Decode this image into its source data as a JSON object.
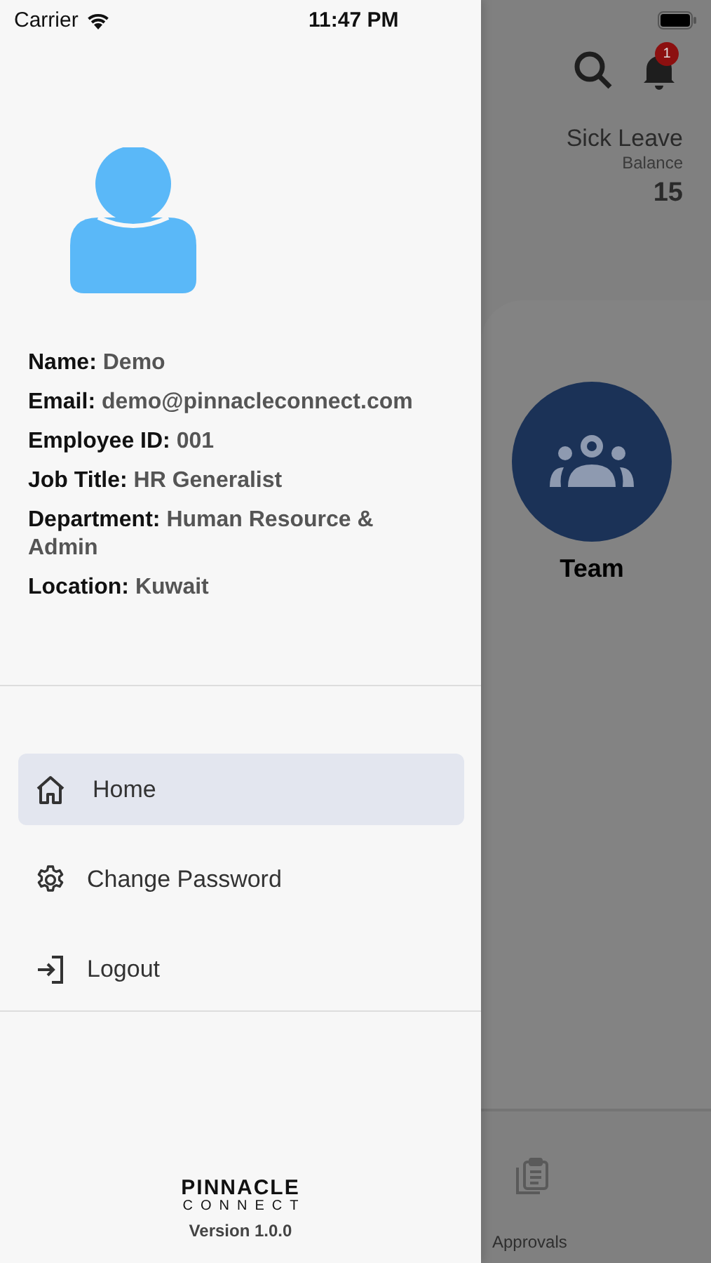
{
  "status_bar": {
    "carrier": "Carrier",
    "time": "11:47 PM"
  },
  "drawer": {
    "profile": [
      {
        "label": "Name:",
        "value": "Demo"
      },
      {
        "label": "Email:",
        "value": "demo@pinnacleconnect.com"
      },
      {
        "label": "Employee ID:",
        "value": "001"
      },
      {
        "label": "Job Title:",
        "value": "HR Generalist"
      },
      {
        "label": "Department:",
        "value": "Human Resource & Admin"
      },
      {
        "label": "Location:",
        "value": "Kuwait"
      }
    ],
    "menu": [
      {
        "label": "Home",
        "kind": "home",
        "selected": true
      },
      {
        "label": "Change Password",
        "kind": "settings",
        "selected": false
      },
      {
        "label": "Logout",
        "kind": "logout",
        "selected": false
      }
    ],
    "footer": {
      "logo_top": "PINNACLE",
      "logo_bottom": "CONNECT",
      "version": "Version 1.0.0"
    }
  },
  "background": {
    "notification_count": "1",
    "leave": {
      "title": "Sick Leave",
      "subtitle": "Balance",
      "value": "15"
    },
    "tile": {
      "label": "Team"
    },
    "tab_bar": [
      {
        "label": "Approvals"
      }
    ]
  }
}
